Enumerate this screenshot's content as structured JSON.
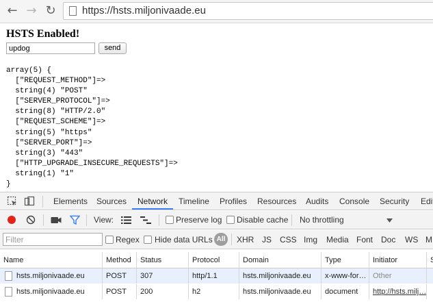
{
  "browser": {
    "url": "https://hsts.miljonivaade.eu"
  },
  "page": {
    "title": "HSTS Enabled!",
    "input_value": "updog",
    "send_label": "send",
    "dump_lines": [
      "array(5) {",
      "  [\"REQUEST_METHOD\"]=>",
      "  string(4) \"POST\"",
      "  [\"SERVER_PROTOCOL\"]=>",
      "  string(8) \"HTTP/2.0\"",
      "  [\"REQUEST_SCHEME\"]=>",
      "  string(5) \"https\"",
      "  [\"SERVER_PORT\"]=>",
      "  string(3) \"443\"",
      "  [\"HTTP_UPGRADE_INSECURE_REQUESTS\"]=>",
      "  string(1) \"1\"",
      "}"
    ]
  },
  "devtools": {
    "tabs": [
      "Elements",
      "Sources",
      "Network",
      "Timeline",
      "Profiles",
      "Resources",
      "Audits",
      "Console",
      "Security",
      "Edit"
    ],
    "active_tab": "Network",
    "controls": {
      "view_label": "View:",
      "preserve_log": "Preserve log",
      "disable_cache": "Disable cache",
      "throttling": "No throttling"
    },
    "filter": {
      "placeholder": "Filter",
      "regex": "Regex",
      "hide_data_urls": "Hide data URLs",
      "all": "All",
      "types": [
        "XHR",
        "JS",
        "CSS",
        "Img",
        "Media",
        "Font",
        "Doc",
        "WS",
        "M"
      ]
    },
    "table": {
      "columns": [
        "Name",
        "Method",
        "Status",
        "Protocol",
        "Domain",
        "Type",
        "Initiator",
        "S"
      ],
      "rows": [
        {
          "name": "hsts.miljonivaade.eu",
          "method": "POST",
          "status": "307",
          "protocol": "http/1.1",
          "domain": "hsts.miljonivaade.eu",
          "type": "x-www-for…",
          "initiator": "Other"
        },
        {
          "name": "hsts.miljonivaade.eu",
          "method": "POST",
          "status": "200",
          "protocol": "h2",
          "domain": "hsts.miljonivaade.eu",
          "type": "document",
          "initiator": "http://hsts.milj…"
        }
      ]
    }
  },
  "colors": {
    "record_red": "#e2231a",
    "accent_blue": "#3e82f7",
    "selected_row": "#e8f0fe"
  },
  "icons": [
    "back-icon",
    "forward-icon",
    "reload-icon",
    "page-icon",
    "inspect-icon",
    "device-icon",
    "record-icon",
    "clear-icon",
    "camera-icon",
    "filter-icon",
    "large-rows-icon",
    "waterfall-icon",
    "dropdown-arrow-icon",
    "file-icon"
  ]
}
